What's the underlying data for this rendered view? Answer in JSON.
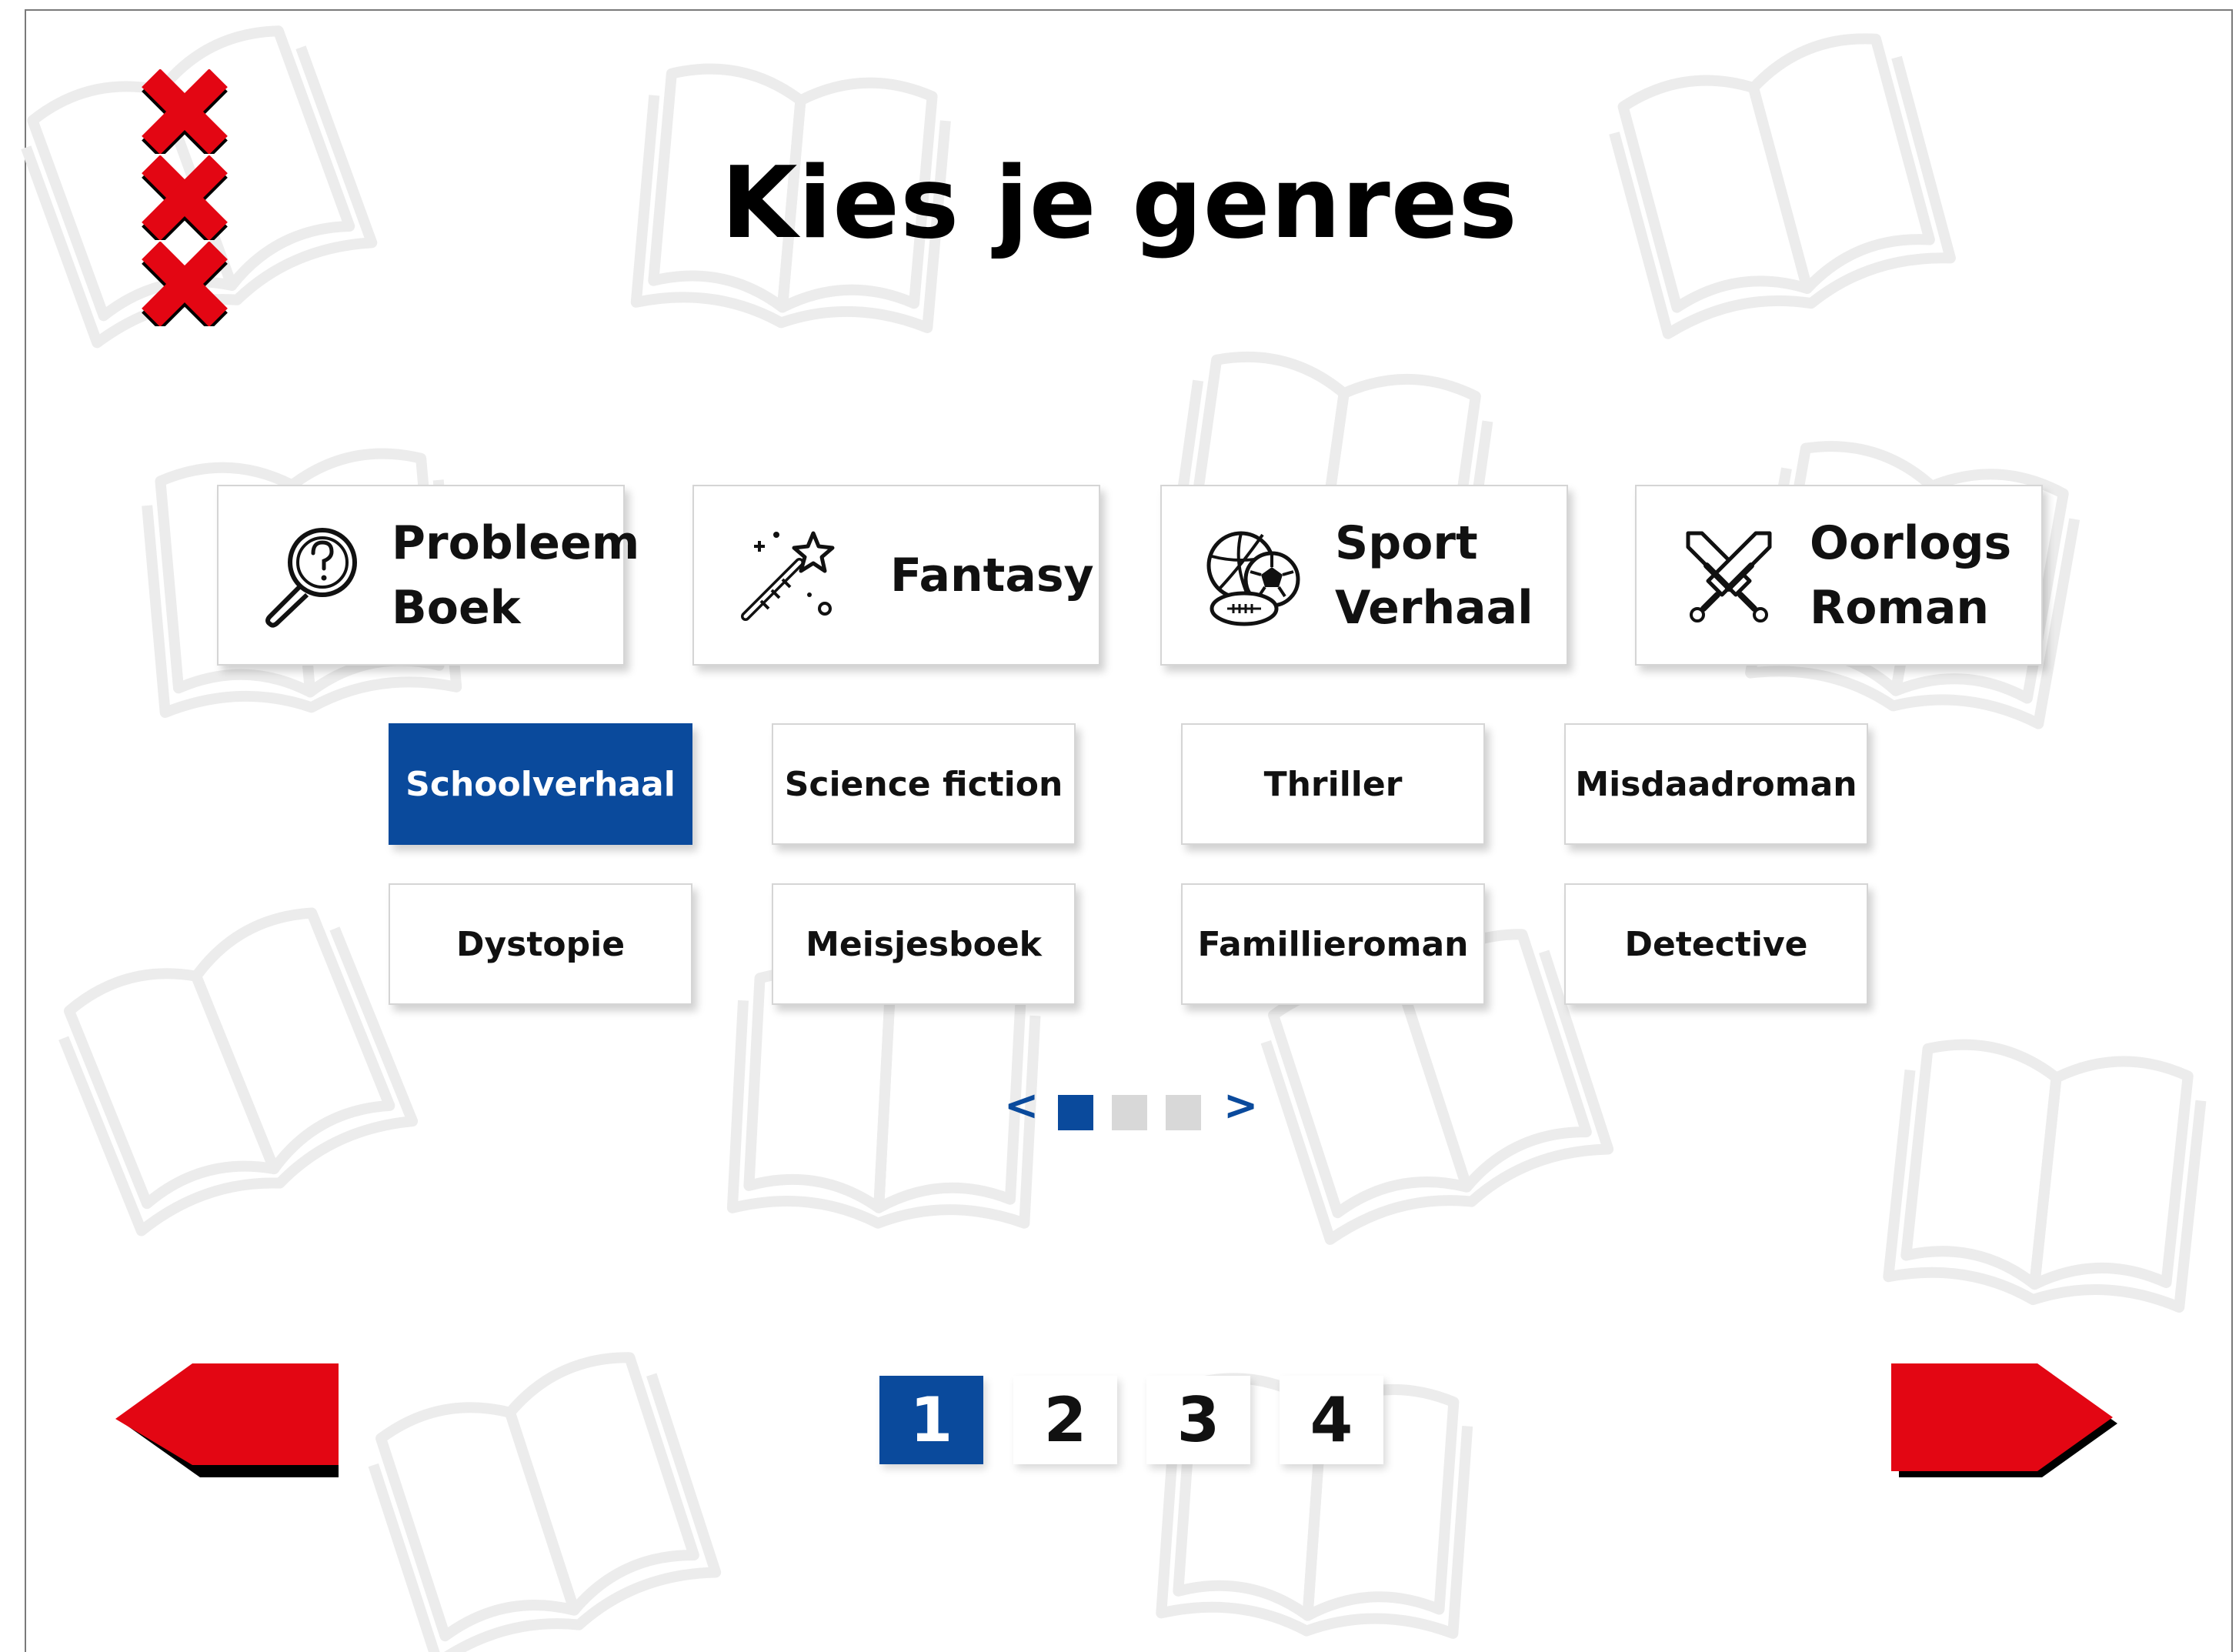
{
  "title": "Kies je genres",
  "colors": {
    "accent_blue": "#0a4a9c",
    "logo_red": "#e30613",
    "arrow_red": "#e30613",
    "inactive_dot": "#d8d8d8"
  },
  "logo": {
    "name": "amsterdam-xxx-icon"
  },
  "main_genres": [
    {
      "label": "Probleem\nBoek",
      "icon": "magnifier-question-icon"
    },
    {
      "label": "Fantasy",
      "icon": "magic-wand-icon"
    },
    {
      "label": "Sport\nVerhaal",
      "icon": "sports-balls-icon"
    },
    {
      "label": "Oorlogs\nRoman",
      "icon": "crossed-swords-icon"
    }
  ],
  "sub_genres": [
    {
      "label": "Schoolverhaal",
      "selected": true
    },
    {
      "label": "Science fiction",
      "selected": false
    },
    {
      "label": "Thriller",
      "selected": false
    },
    {
      "label": "Misdaadroman",
      "selected": false
    },
    {
      "label": "Dystopie",
      "selected": false
    },
    {
      "label": "Meisjesboek",
      "selected": false
    },
    {
      "label": "Famillieroman",
      "selected": false
    },
    {
      "label": "Detective",
      "selected": false
    }
  ],
  "carousel": {
    "prev": "<",
    "next": ">",
    "dots": 3,
    "active": 1
  },
  "pagination": {
    "pages": [
      "1",
      "2",
      "3",
      "4"
    ],
    "active": "1"
  },
  "nav": {
    "back_icon": "arrow-left-icon",
    "next_icon": "arrow-right-icon"
  }
}
